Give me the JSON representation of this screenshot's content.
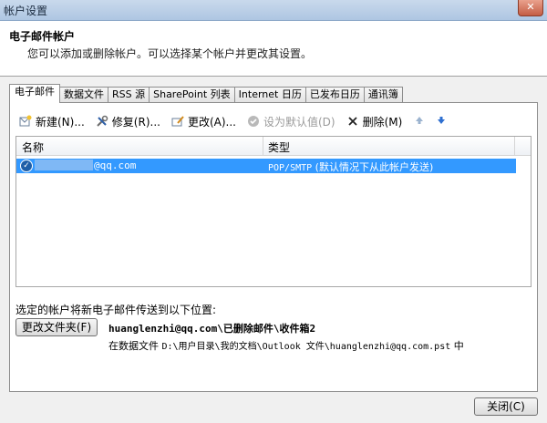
{
  "window": {
    "title": "帐户设置",
    "close_glyph": "✕"
  },
  "header": {
    "title": "电子邮件帐户",
    "subtitle": "您可以添加或删除帐户。可以选择某个帐户并更改其设置。"
  },
  "tabs": [
    {
      "label": "电子邮件"
    },
    {
      "label": "数据文件"
    },
    {
      "label": "RSS 源"
    },
    {
      "label": "SharePoint 列表"
    },
    {
      "label": "Internet 日历"
    },
    {
      "label": "已发布日历"
    },
    {
      "label": "通讯簿"
    }
  ],
  "toolbar": {
    "new_label": "新建(N)...",
    "repair_label": "修复(R)...",
    "change_label": "更改(A)...",
    "set_default_label": "设为默认值(D)",
    "remove_label": "删除(M)",
    "icons": {
      "new": "new-icon",
      "repair": "tools-icon",
      "change": "change-icon",
      "set_default": "check-circle-icon",
      "remove": "delete-x-icon",
      "up": "arrow-up-icon",
      "down": "arrow-down-icon"
    }
  },
  "account_list": {
    "col_name": "名称",
    "col_type": "类型",
    "rows": [
      {
        "name_visible": "@qq.com",
        "type_protocol": "POP/SMTP",
        "type_note": "(默认情况下从此帐户发送)",
        "selected": true
      }
    ]
  },
  "delivery": {
    "label": "选定的帐户将新电子邮件传送到以下位置:",
    "change_folder_button": "更改文件夹(F)",
    "folder_path": "huanglenzhi@qq.com\\已删除邮件\\收件箱2",
    "data_file_prefix": "在数据文件",
    "data_file_path": "D:\\用户目录\\我的文档\\Outlook 文件\\huanglenzhi@qq.com.pst",
    "data_file_suffix": "中"
  },
  "footer": {
    "close_button": "关闭(C)"
  },
  "colors": {
    "selection": "#3399ff",
    "titlebar": "#aec6e2",
    "close_red": "#c45d44"
  }
}
